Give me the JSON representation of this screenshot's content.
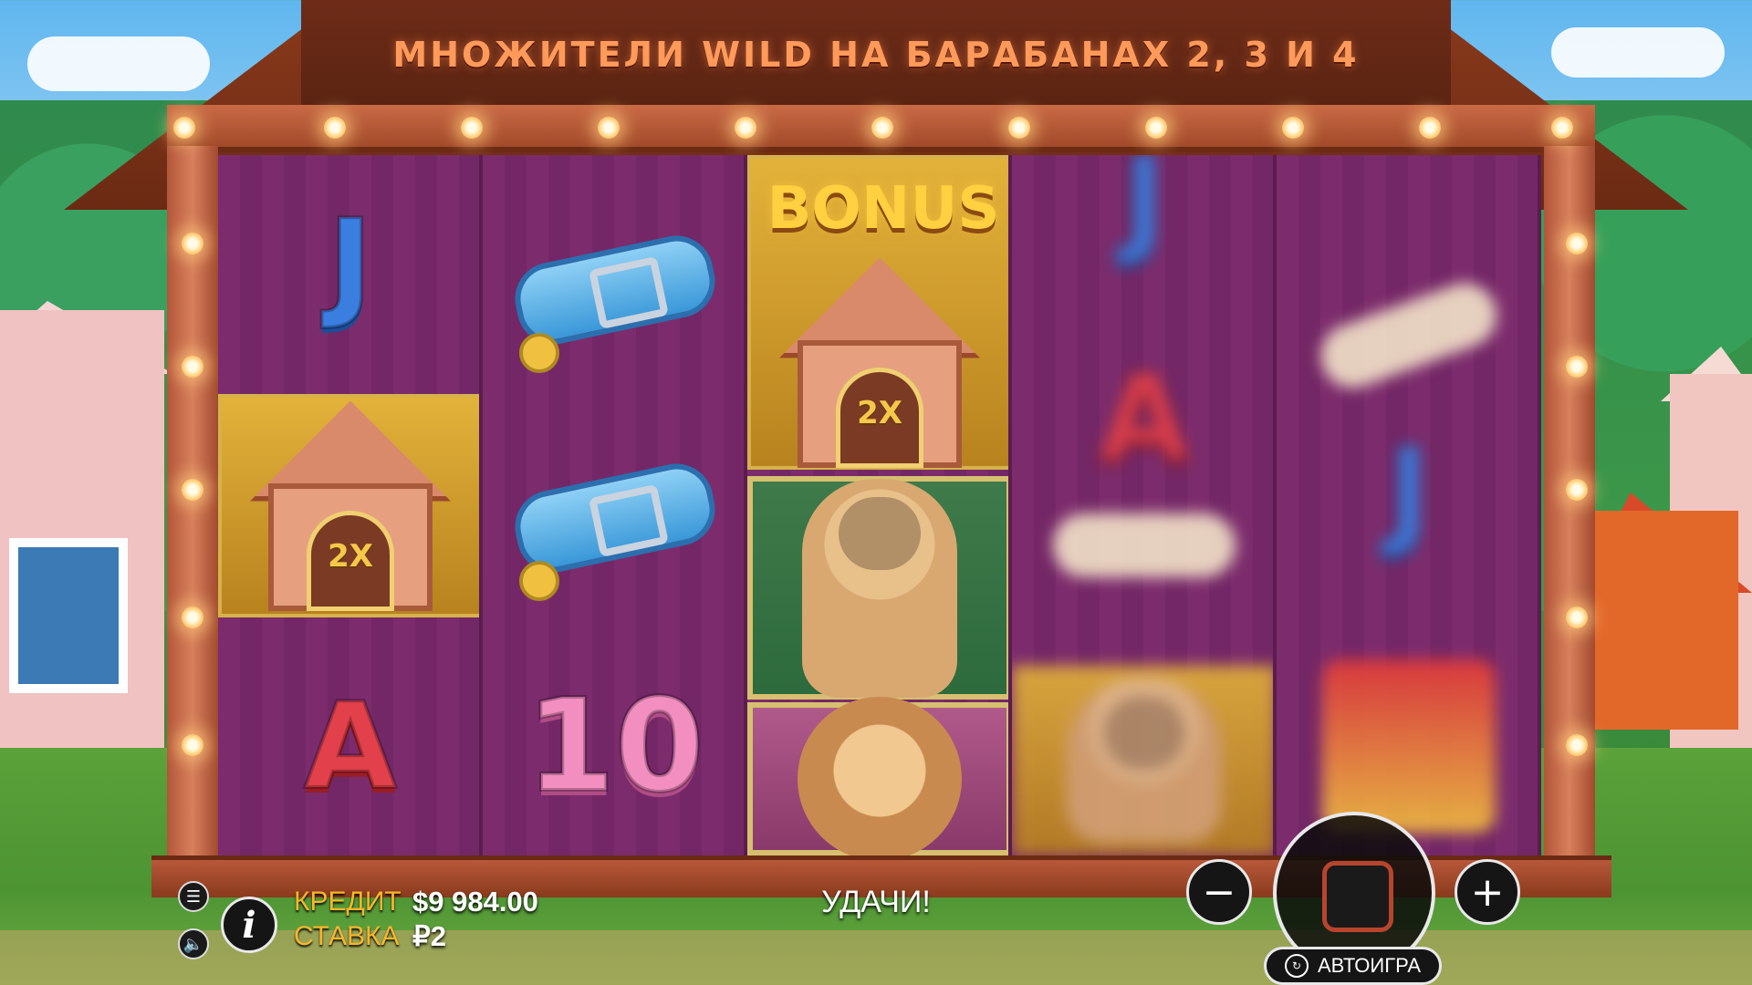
{
  "header": {
    "title": "МНОЖИТЕЛИ WILD НА БАРАБАНАХ 2, 3 И 4"
  },
  "reels": [
    {
      "symbols": [
        "J",
        "dog-house-2x",
        "A"
      ]
    },
    {
      "symbols": [
        "collar",
        "collar",
        "10"
      ]
    },
    {
      "symbols": [
        "bonus-dog-house-2x",
        "pug",
        "yorkie"
      ]
    },
    {
      "symbols": [
        "J",
        "A",
        "bone",
        "pug-blur"
      ]
    },
    {
      "symbols": [
        "bone",
        "J",
        "gift"
      ]
    }
  ],
  "symbol_labels": {
    "j": "J",
    "a": "A",
    "ten": "10",
    "bonus": "BONUS",
    "multiplier": "2X"
  },
  "status": {
    "credit_label": "КРЕДИТ",
    "credit_value": "$9 984.00",
    "bet_label": "СТАВКА",
    "bet_value": "₽2",
    "message": "УДАЧИ!"
  },
  "controls": {
    "minus_label": "−",
    "plus_label": "+",
    "autoplay_label": "АВТОИГРА",
    "info_label": "i",
    "menu_icon": "hamburger-icon",
    "sound_icon": "speaker-icon"
  },
  "colors": {
    "label_gold": "#f6b72a",
    "reel_purple": "#7c2c6c",
    "frame_wood": "#b2563a",
    "title_orange": "#ff9a5a"
  }
}
